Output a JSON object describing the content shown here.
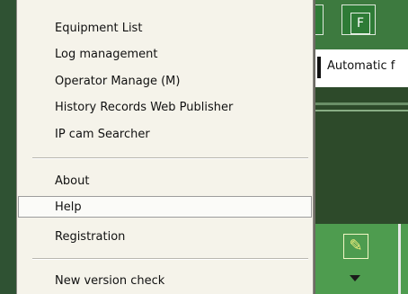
{
  "menu": {
    "items_top": [
      {
        "label": "Equipment List",
        "name": "menu-item-equipment-list"
      },
      {
        "label": "Log management",
        "name": "menu-item-log-management"
      },
      {
        "label": "Operator Manage (M)",
        "name": "menu-item-operator-manage"
      },
      {
        "label": "History Records Web Publisher",
        "name": "menu-item-history-records-web-publisher"
      },
      {
        "label": "IP cam Searcher",
        "name": "menu-item-ip-cam-searcher"
      }
    ],
    "items_middle": [
      {
        "label": "About",
        "name": "menu-item-about"
      },
      {
        "label": "Help",
        "name": "menu-item-help",
        "highlighted": true
      },
      {
        "label": "Registration",
        "name": "menu-item-registration"
      }
    ],
    "items_bottom": [
      {
        "label": "New version check",
        "name": "menu-item-new-version-check"
      }
    ]
  },
  "background_app": {
    "button_letter": "F",
    "checkbox_label": "Automatic f"
  },
  "colors": {
    "menu_background": "#f5f3ea",
    "app_green": "#3d7a3f",
    "app_dark_green": "#2d4a2a"
  }
}
